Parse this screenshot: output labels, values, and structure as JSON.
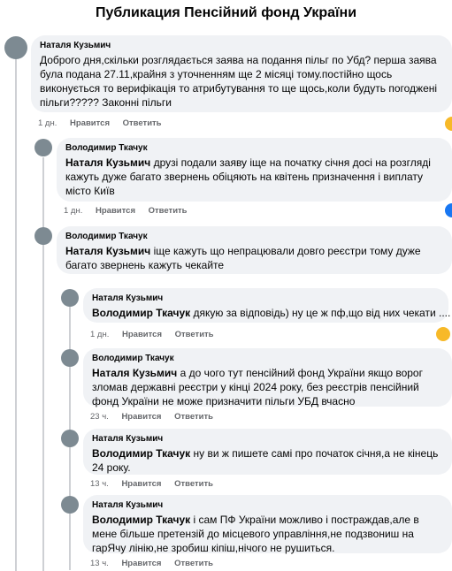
{
  "title": "Публикация Пенсійний фонд України",
  "actions": {
    "like": "Нравится",
    "reply": "Ответить"
  },
  "comments": [
    {
      "author": "Наталя Кузьмич",
      "mention": "",
      "text": "Доброго дня,скільки розглядається заява на подання пільг по Убд? перша заява була подана 27.11,крайня з уточненням ще 2 місяці тому.постійно щось виконується то верифікація то атрибутування то ще щось,коли будуть погоджені пільги????? Законні пільги",
      "time": "1 дн."
    },
    {
      "author": "Володимир Ткачук",
      "mention": "Наталя Кузьмич",
      "text": " друзі подали заяву іще на початку січня досі на розгляді кажуть дуже багато звернень обіцяють на квітень призначення і виплату місто Київ",
      "time": "1 дн."
    },
    {
      "author": "Володимир Ткачук",
      "mention": "Наталя Кузьмич",
      "text": " іще кажуть що непрацювали довго реєстри тому дуже багато звернень кажуть чекайте",
      "time": ""
    },
    {
      "author": "Наталя Кузьмич",
      "mention": "Володимир Ткачук",
      "text": " дякую за відповідь) ну це ж пф,що від них чекати ....",
      "time": "1 дн."
    },
    {
      "author": "Володимир Ткачук",
      "mention": "Наталя Кузьмич",
      "text": " а до чого тут пенсійний фонд України якщо ворог зломав державні реєстри у кінці 2024 року, без реєстрів пенсійний фонд України не може призначити пільги УБД вчасно",
      "time": "23 ч."
    },
    {
      "author": "Наталя Кузьмич",
      "mention": "Володимир Ткачук",
      "text": " ну ви ж пишете самі про початок січня,а не кінець 24 року.",
      "time": "13 ч."
    },
    {
      "author": "Наталя Кузьмич",
      "mention": "Володимир Ткачук",
      "text": " і сам ПФ України можливо і постраждав,але в мене більше претензій до місцевого управління,не подзвониш на гарЯчу лінію,не зробиш кіпіш,нічого не рушиться.",
      "time": "13 ч."
    }
  ],
  "colors": {
    "bubble": "#f0f2f5",
    "meta": "#65676b",
    "line": "#ced0d4"
  }
}
